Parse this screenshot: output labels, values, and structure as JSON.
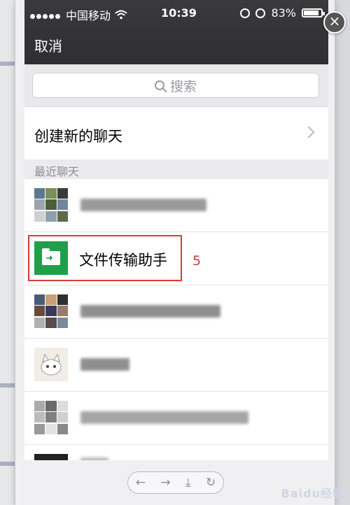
{
  "status_bar": {
    "carrier": "中国移动",
    "time": "10:39",
    "battery": "83%",
    "battery_level": 0.83
  },
  "nav": {
    "cancel_label": "取消",
    "close_symbol": "×"
  },
  "search": {
    "placeholder": "搜索"
  },
  "create_chat": {
    "label": "创建新的聊天"
  },
  "recent": {
    "header": "最近聊天",
    "items": [
      {
        "name": "",
        "obscured": true,
        "avatar": "group-avatar"
      },
      {
        "name": "文件传输助手",
        "obscured": false,
        "avatar": "file-transfer-icon",
        "annotation": "5"
      },
      {
        "name": "",
        "obscured": true,
        "avatar": "group-avatar"
      },
      {
        "name": "",
        "obscured": true,
        "avatar": "cat-avatar"
      },
      {
        "name": "",
        "obscured": true,
        "avatar": "group-avatar"
      },
      {
        "name": "",
        "obscured": true,
        "avatar": "dark-avatar"
      }
    ]
  },
  "bottom_toolbar": {
    "icons": [
      "back-arrow-icon",
      "forward-arrow-icon",
      "download-icon",
      "refresh-icon"
    ]
  },
  "watermark": "Baidu经验",
  "colors": {
    "nav_bg": "#2f2f31",
    "highlight": "#d93a3a",
    "file_icon": "#1ea04a"
  }
}
